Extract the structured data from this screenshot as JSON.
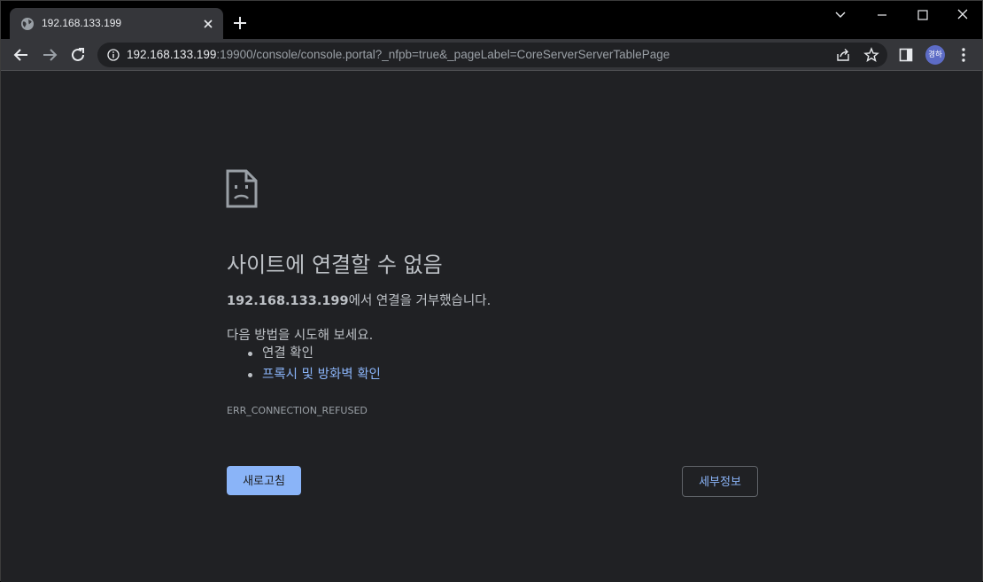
{
  "tab": {
    "title": "192.168.133.199",
    "favicon": "globe-icon"
  },
  "toolbar": {
    "url_host": "192.168.133.199",
    "url_rest": ":19900/console/console.portal?_nfpb=true&_pageLabel=CoreServerServerTablePage",
    "avatar_text": "경하"
  },
  "error": {
    "title": "사이트에 연결할 수 없음",
    "desc_host": "192.168.133.199",
    "desc_suffix": "에서 연결을 거부했습니다.",
    "try_label": "다음 방법을 시도해 보세요.",
    "suggestions": [
      {
        "label": "연결 확인",
        "link": false
      },
      {
        "label": "프록시 및 방화벽 확인",
        "link": true
      }
    ],
    "code": "ERR_CONNECTION_REFUSED",
    "reload_label": "새로고침",
    "details_label": "세부정보"
  },
  "colors": {
    "page_bg": "#202124",
    "toolbar_bg": "#35363a",
    "accent": "#8ab4f8",
    "text": "#bdc1c6"
  }
}
